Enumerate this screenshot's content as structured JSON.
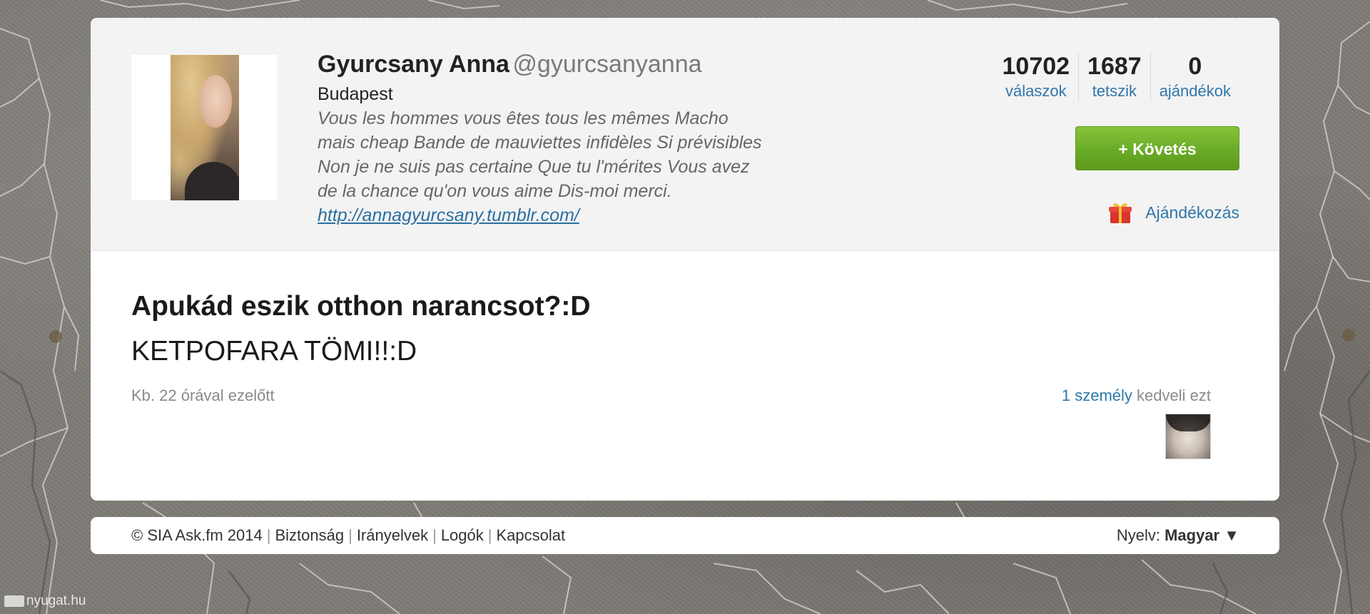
{
  "profile": {
    "name": "Gyurcsany Anna",
    "username": "@gyurcsanyanna",
    "location": "Budapest",
    "bio_lines": [
      "Vous les hommes vous êtes tous les mêmes Macho",
      "mais cheap Bande de mauviettes infidèles Si prévisibles",
      "Non je ne suis pas certaine Que tu l'mérites Vous avez",
      "de la chance qu'on vous aime Dis-moi merci."
    ],
    "bio_link": "http://annagyurcsany.tumblr.com/",
    "avatar_icon": "profile-photo"
  },
  "stats": [
    {
      "count": "10702",
      "label": "válaszok"
    },
    {
      "count": "1687",
      "label": "tetszik"
    },
    {
      "count": "0",
      "label": "ajándékok"
    }
  ],
  "actions": {
    "follow_label": "+ Követés",
    "gift_label": "Ajándékozás",
    "gift_icon": "gift-icon"
  },
  "post": {
    "question": "Apukád eszik otthon narancsot?:D",
    "answer": "KETPOFARA TÖMI!!:D",
    "timestamp": "Kb. 22 órával ezelőtt",
    "likes_count": "1 személy",
    "likes_rest": "kedveli ezt"
  },
  "footer": {
    "copyright": "© SIA Ask.fm 2014",
    "links": [
      "Biztonság",
      "Irányelvek",
      "Logók",
      "Kapcsolat"
    ],
    "language_label": "Nyelv:",
    "language_value": "Magyar ▼"
  },
  "watermark": "nyugat.hu",
  "colors": {
    "link": "#2f76a8",
    "follow_button": "#69ab27",
    "header_bg": "#f3f3f3"
  }
}
